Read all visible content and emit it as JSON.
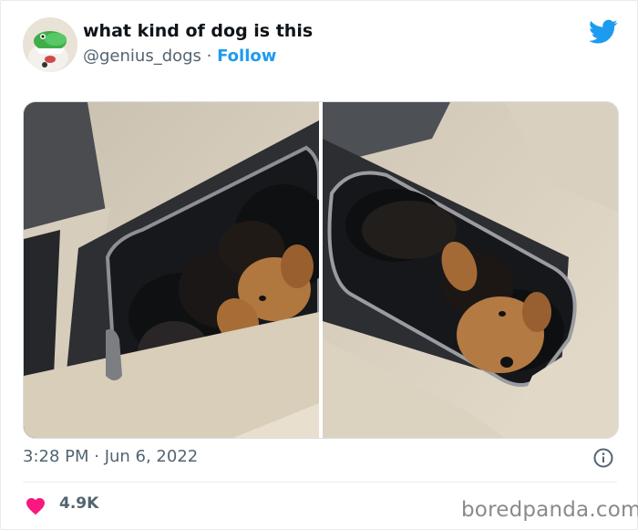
{
  "tweet": {
    "display_name": "what kind of dog is this",
    "handle": "@genius_dogs",
    "separator": " · ",
    "follow_label": "Follow",
    "timestamp": "3:28 PM · Jun 6, 2022",
    "like_count": "4.9K"
  },
  "icons": {
    "brand": "twitter-bird-icon",
    "info": "info-icon",
    "like": "heart-icon"
  },
  "colors": {
    "accent": "#1d9bf0",
    "like": "#f91880",
    "text_secondary": "#536471"
  },
  "watermark": "boredpanda.com"
}
